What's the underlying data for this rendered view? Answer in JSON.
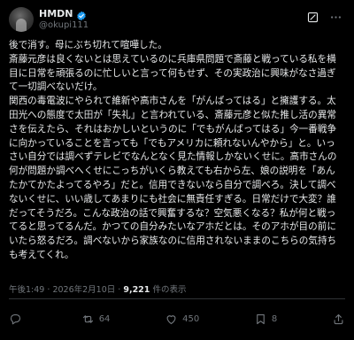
{
  "author": {
    "display_name": "HMDN",
    "handle": "@okupi111"
  },
  "icons": {
    "verified": "verified-badge-icon",
    "grok": "grok-icon",
    "more": "more-options-icon",
    "reply": "reply-icon",
    "repost": "repost-icon",
    "like": "like-icon",
    "bookmark": "bookmark-icon",
    "share": "share-icon"
  },
  "colors": {
    "background": "#000000",
    "text": "#e7e9ea",
    "secondary": "#71767b",
    "verified": "#1d9bf0"
  },
  "post": {
    "paragraphs": [
      "後で消す。母にぶち切れて喧嘩した。",
      "斎藤元彦は良くないとは思えているのに兵庫県問題で斎藤と戦っている私を横目に日常を頑張るのに忙しいと言って何もせず、その実政治に興味がなさ過ぎて一切調べないだけ。",
      "関西の毒電波にやられて維新や高市さんを「がんばってはる」と擁護する。太田光への態度で太田が「失礼」と言われている、斎藤元彦と似た推し活の異常さを伝えたら、それはおかしいというのに「でもがんばってはる」今一番戦争に向かっていることを言っても「でもアメリカに頼れないんやから」と。いっさい自分では調べずテレビでなんとなく見た情報しかないくせに。高市さんの何が問題か調べへくせにこっちがいくら教えても右から左、娘の説明を「あんたかてかたよってるやろ」だと。信用できないなら自分で調べろ。決して調べないくせに、いい歳してあまりにも社会に無責任すぎる。日常だけで大変？誰だってそうだろ。こんな政治の話で興奮するな？空気悪くなる？私が何と戦ってると思ってるんだ。かつての自分みたいなアホだとは。そのアホが目の前にいたら怒るだろ。調べないから家族なのに信用されないままのこちらの気持ちも考えてくれ。"
    ],
    "time": "午後1:49",
    "date": "2026年2月10日",
    "separator": "·",
    "views_count": "9,221",
    "views_label": "件の表示"
  },
  "actions": {
    "replies": "",
    "reposts": "64",
    "likes": "450",
    "bookmarks": "8"
  }
}
